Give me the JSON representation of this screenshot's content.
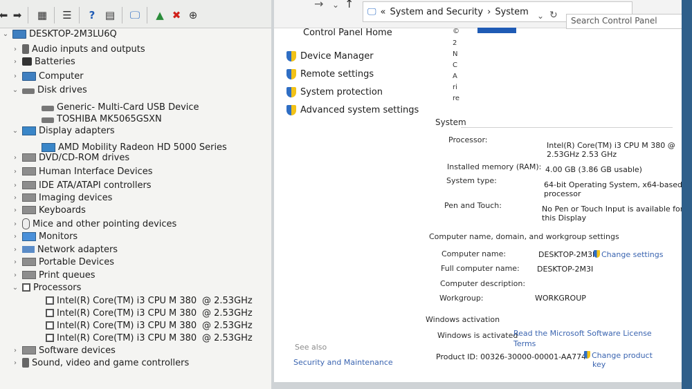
{
  "device_manager": {
    "toolbar_icons": [
      "back-arrow-icon",
      "forward-arrow-icon",
      "properties-icon",
      "list-view-icon",
      "help-icon",
      "details-icon",
      "monitor-icon",
      "update-driver-icon",
      "uninstall-x-icon",
      "download-icon"
    ],
    "root": "DESKTOP-2M3LU6Q",
    "categories": [
      {
        "label": "Audio inputs and outputs",
        "expanded": false
      },
      {
        "label": "Batteries",
        "expanded": false
      },
      {
        "label": "Computer",
        "expanded": false
      },
      {
        "label": "Disk drives",
        "expanded": true,
        "children": [
          "Generic- Multi-Card USB Device",
          "TOSHIBA MK5065GSXN"
        ]
      },
      {
        "label": "Display adapters",
        "expanded": true,
        "children": [
          "AMD Mobility Radeon HD 5000 Series"
        ]
      },
      {
        "label": "DVD/CD-ROM drives",
        "expanded": false
      },
      {
        "label": "Human Interface Devices",
        "expanded": false
      },
      {
        "label": "IDE ATA/ATAPI controllers",
        "expanded": false
      },
      {
        "label": "Imaging devices",
        "expanded": false
      },
      {
        "label": "Keyboards",
        "expanded": false
      },
      {
        "label": "Mice and other pointing devices",
        "expanded": false
      },
      {
        "label": "Monitors",
        "expanded": false
      },
      {
        "label": "Network adapters",
        "expanded": false
      },
      {
        "label": "Portable Devices",
        "expanded": false
      },
      {
        "label": "Print queues",
        "expanded": false
      },
      {
        "label": "Processors",
        "expanded": true
      },
      {
        "label": "Software devices",
        "expanded": false
      },
      {
        "label": "Sound, video and game controllers",
        "expanded": false
      }
    ],
    "processors": [
      {
        "name": "Intel(R) Core(TM) i3 CPU",
        "model": "M 380",
        "freq": "@ 2.53GHz"
      },
      {
        "name": "Intel(R) Core(TM) i3 CPU",
        "model": "M 380",
        "freq": "@ 2.53GHz"
      },
      {
        "name": "Intel(R) Core(TM) i3 CPU",
        "model": "M 380",
        "freq": "@ 2.53GHz"
      },
      {
        "name": "Intel(R) Core(TM) i3 CPU",
        "model": "M 380",
        "freq": "@ 2.53GHz"
      }
    ]
  },
  "control_panel": {
    "breadcrumb": [
      "«",
      "System and Security",
      "›",
      "System"
    ],
    "search_placeholder": "Search Control Panel",
    "home": "Control Panel Home",
    "nav_links": [
      "Device Manager",
      "Remote settings",
      "System protection",
      "Advanced system settings"
    ],
    "see_also": "See also",
    "see_also_link": "Security and Maintenance",
    "cut_text": [
      "©",
      "2",
      "N",
      "C",
      "A",
      "ri",
      "re"
    ],
    "system_heading": "System",
    "system_rows": [
      {
        "label": "Processor:",
        "value": "Intel(R) Core(TM) i3 CPU     M 380 @",
        "value2": "2.53GHz  2.53 GHz"
      },
      {
        "label": "Installed memory (RAM):",
        "value": "4.00 GB (3.86 GB usable)"
      },
      {
        "label": "System type:",
        "value": "64-bit Operating System, x64-based",
        "value2": "processor"
      },
      {
        "label": "Pen and Touch:",
        "value": "No Pen or Touch Input is available for",
        "value2": "this Display"
      }
    ],
    "computer_heading": "Computer name, domain, and workgroup settings",
    "computer_rows": [
      {
        "label": "Computer name:",
        "value": "DESKTOP-2M3I"
      },
      {
        "label": "Full computer name:",
        "value": "DESKTOP-2M3I"
      },
      {
        "label": "Computer description:",
        "value": ""
      },
      {
        "label": "Workgroup:",
        "value": "WORKGROUP"
      }
    ],
    "change_settings": "Change settings",
    "activation_heading": "Windows activation",
    "activation_status": "Windows is activated",
    "license_link": "Read the Microsoft Software License",
    "license_link2": "Terms",
    "product_id": "Product ID: 00326-30000-00001-AA774",
    "change_key": "Change product",
    "change_key2": "key"
  }
}
